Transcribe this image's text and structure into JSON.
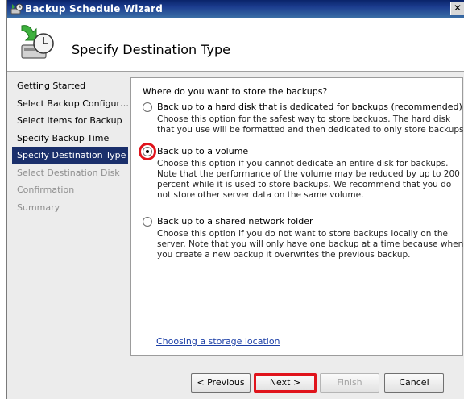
{
  "window": {
    "title": "Backup Schedule Wizard",
    "close_label": "✕"
  },
  "header": {
    "title": "Specify Destination Type"
  },
  "nav": {
    "items": [
      {
        "label": "Getting Started",
        "state": "normal"
      },
      {
        "label": "Select Backup Configur…",
        "state": "normal"
      },
      {
        "label": "Select Items for Backup",
        "state": "normal"
      },
      {
        "label": "Specify Backup Time",
        "state": "normal"
      },
      {
        "label": "Specify Destination Type",
        "state": "active"
      },
      {
        "label": "Select Destination Disk",
        "state": "disabled"
      },
      {
        "label": "Confirmation",
        "state": "disabled"
      },
      {
        "label": "Summary",
        "state": "disabled"
      }
    ]
  },
  "content": {
    "question": "Where do you want to store the backups?",
    "options": [
      {
        "label": "Back up to a hard disk that is dedicated for backups (recommended)",
        "desc": "Choose this option for the safest way to store backups. The hard disk that you use will be formatted and then dedicated to only store backups.",
        "checked": false
      },
      {
        "label": "Back up to a volume",
        "desc": "Choose this option if you cannot dedicate an entire disk for backups. Note that the performance of the volume may be reduced by up to 200 percent while it is used to store backups. We recommend that you do not store other server data on the same volume.",
        "checked": true
      },
      {
        "label": "Back up to a shared network folder",
        "desc": "Choose this option if you do not want to store backups locally on the server. Note that you will only have one backup at a time because when you create a new backup it overwrites the previous backup.",
        "checked": false
      }
    ],
    "link": "Choosing a storage location"
  },
  "buttons": {
    "previous": "< Previous",
    "next": "Next >",
    "finish": "Finish",
    "cancel": "Cancel"
  },
  "colors": {
    "title_bar": "#0a246a",
    "nav_active": "#1a2f6b",
    "annotation": "#e0141c",
    "link": "#1b3ea6"
  }
}
